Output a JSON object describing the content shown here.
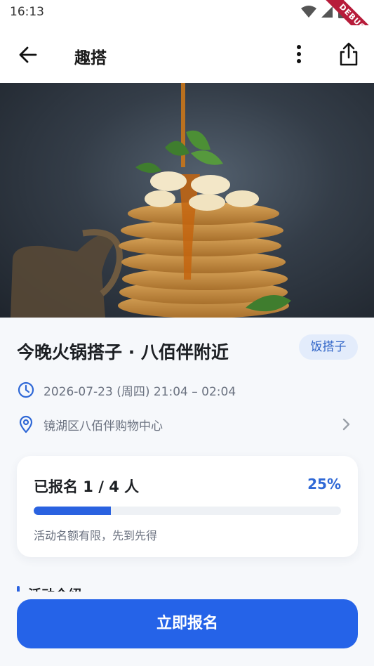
{
  "status_bar": {
    "time": "16:13",
    "debug_label": "DEBUG"
  },
  "app_bar": {
    "title": "趣搭"
  },
  "event": {
    "title": "今晚火锅搭子 · 八佰伴附近",
    "category": "饭搭子",
    "time_text": "2026-07-23 (周四) 21:04 – 02:04",
    "location_text": "镜湖区八佰伴购物中心"
  },
  "signup": {
    "count_text": "已报名 1 / 4 人",
    "percent_text": "25%",
    "progress": 0.25,
    "note": "活动名额有限，先到先得"
  },
  "section": {
    "title": "活动介绍"
  },
  "action": {
    "join_label": "立即报名"
  },
  "colors": {
    "accent": "#2563e8",
    "tag_bg": "#e3ecfb",
    "tag_text": "#3266c8"
  },
  "icons": {
    "back": "arrow-left-icon",
    "more": "more-vertical-icon",
    "share": "share-icon",
    "time": "clock-icon",
    "location": "location-pin-icon",
    "chevron": "chevron-right-icon"
  }
}
